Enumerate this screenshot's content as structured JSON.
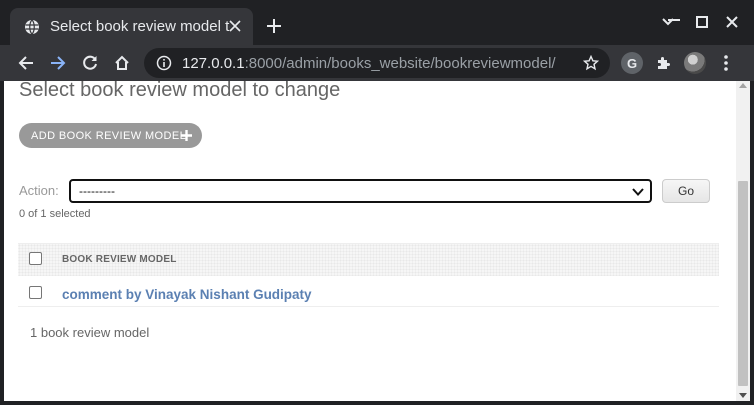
{
  "browser": {
    "tab_title": "Select book review model to change | Django site admin",
    "url_host": "127.0.0.1",
    "url_rest": ":8000/admin/books_website/bookreviewmodel/",
    "extension_letter": "G"
  },
  "page": {
    "title": "Select book review model to change",
    "add_button_label": "ADD BOOK REVIEW MODEL",
    "action_label": "Action:",
    "action_selected": "---------",
    "go_label": "Go",
    "selected_count": "0 of 1 selected",
    "column_header": "BOOK REVIEW MODEL",
    "rows": [
      {
        "label": "comment by Vinayak Nishant Gudipaty"
      }
    ],
    "paginator": "1 book review model"
  },
  "colors": {
    "chrome_dark": "#202124",
    "chrome_toolbar": "#35363a",
    "link": "#5b80b2",
    "add_button": "#999999"
  }
}
